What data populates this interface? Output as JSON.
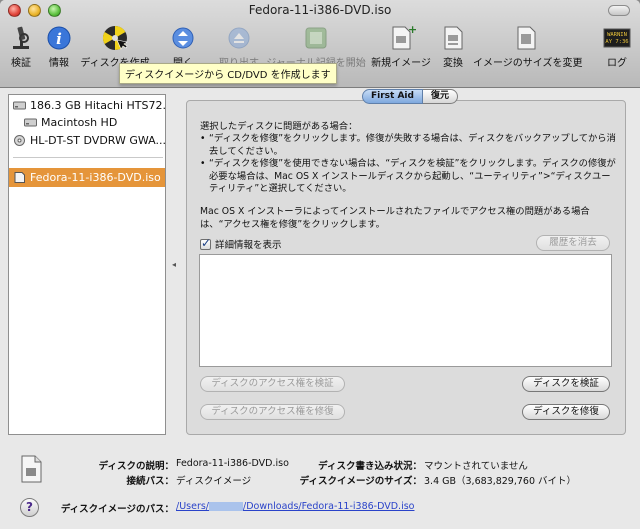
{
  "window": {
    "title": "Fedora-11-i386-DVD.iso"
  },
  "toolbar": {
    "buttons": [
      {
        "label": "検証",
        "icon": "microscope-icon",
        "enabled": true
      },
      {
        "label": "情報",
        "icon": "info-icon",
        "enabled": true
      },
      {
        "label": "ディスクを作成",
        "icon": "burn-disc-icon",
        "enabled": true
      },
      {
        "label": "開く",
        "icon": "open-icon",
        "enabled": true
      },
      {
        "label": "取り出す",
        "icon": "eject-icon",
        "enabled": false
      },
      {
        "label": "ジャーナル記録を開始",
        "icon": "journal-icon",
        "enabled": false
      },
      {
        "label": "新規イメージ",
        "icon": "new-image-icon",
        "enabled": true
      },
      {
        "label": "変換",
        "icon": "convert-icon",
        "enabled": true
      },
      {
        "label": "イメージのサイズを変更",
        "icon": "resize-image-icon",
        "enabled": true
      },
      {
        "label": "ログ",
        "icon": "log-icon",
        "enabled": true,
        "icon_text": "WARNIN\nAY 7:36"
      }
    ],
    "tooltip": "ディスクイメージから CD/DVD を作成します"
  },
  "sidebar": {
    "items": [
      {
        "label": "186.3 GB Hitachi HTS72...",
        "icon": "hard-disk-icon"
      },
      {
        "label": "Macintosh HD",
        "icon": "volume-icon"
      },
      {
        "label": "HL-DT-ST DVDRW GWA...",
        "icon": "optical-drive-icon"
      },
      {
        "label": "Fedora-11-i386-DVD.iso",
        "icon": "disk-image-icon",
        "selected": true
      }
    ]
  },
  "tabs": {
    "first_aid": "First Aid",
    "restore": "復元"
  },
  "first_aid": {
    "intro": "選択したディスクに問題がある場合：",
    "bullet1": "“ディスクを修復”をクリックします。修復が失敗する場合は、ディスクをバックアップしてから消去してください。",
    "bullet2": "“ディスクを修復”を使用できない場合は、“ディスクを検証”をクリックします。ディスクの修復が必要な場合は、Mac OS X インストールディスクから起動し、“ユーティリティ”>“ディスクユーティリティ”と選択してください。",
    "permissions_note": "Mac OS X インストーラによってインストールされたファイルでアクセス権の問題がある場合は、“アクセス権を修復”をクリックします。",
    "show_details": "詳細情報を表示",
    "show_details_checked": true,
    "clear_history": "履歴を消去",
    "verify_permissions": "ディスクのアクセス権を検証",
    "repair_permissions": "ディスクのアクセス権を修復",
    "verify_disk": "ディスクを検証",
    "repair_disk": "ディスクを修復"
  },
  "info": {
    "description_label": "ディスクの説明：",
    "description_value": "Fedora-11-i386-DVD.iso",
    "connection_label": "接続パス：",
    "connection_value": "ディスクイメージ",
    "write_status_label": "ディスク書き込み状況：",
    "write_status_value": "マウントされていません",
    "image_size_label": "ディスクイメージのサイズ：",
    "image_size_value": "3.4 GB（3,683,829,760 バイト）",
    "path_label": "ディスクイメージのパス：",
    "path_prefix": "/Users/",
    "path_suffix": "/Downloads/Fedora-11-i386-DVD.iso"
  },
  "help": "?"
}
